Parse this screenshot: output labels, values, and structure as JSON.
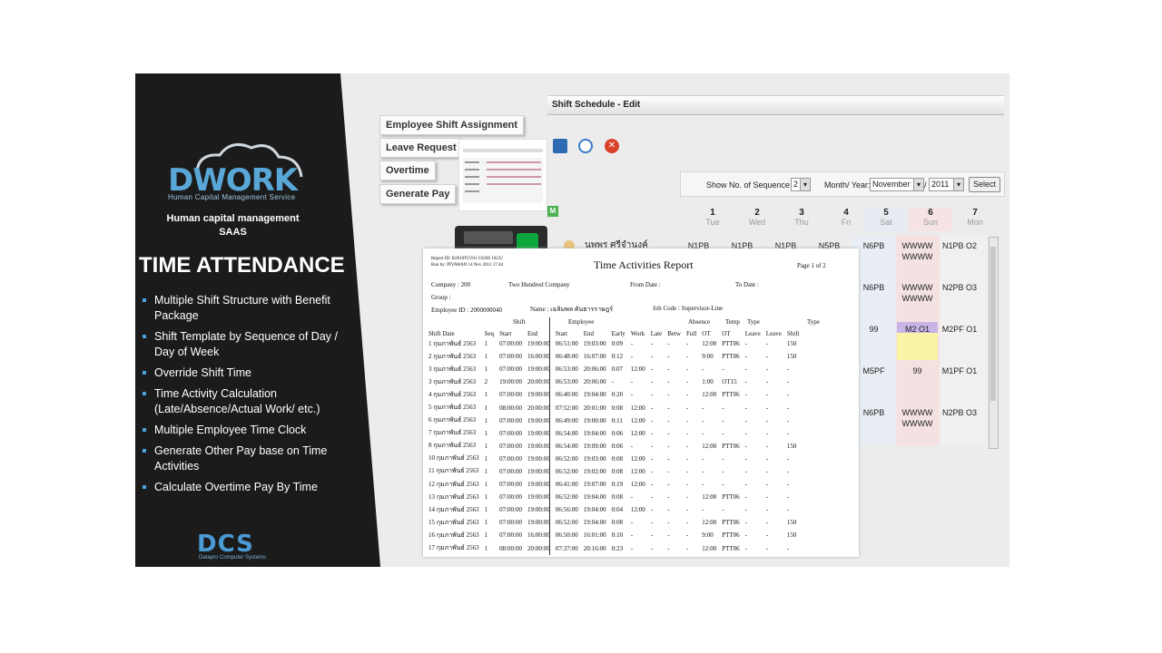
{
  "brand": {
    "logo": "DWORK",
    "logo_sub": "Human Capital Management Service",
    "tagline_1": "Human capital management",
    "tagline_2": "SAAS"
  },
  "title": "TIME ATTENDANCE",
  "features": [
    "Multiple Shift Structure with Benefit Package",
    "Shift Template by Sequence of Day / Day of Week",
    "Override Shift Time",
    "Time Activity Calculation (Late/Absence/Actual Work/ etc.)",
    "Multiple Employee Time Clock",
    "Generate Other Pay base on Time Activities",
    "Calculate Overtime Pay By Time"
  ],
  "footer_logo": {
    "text": "DCS",
    "sub": "Datapro Computer Systems"
  },
  "nav": [
    "Employee Shift Assignment",
    "Leave Request",
    "Overtime",
    "Generate Pay"
  ],
  "schedule": {
    "title": "Shift Schedule - Edit",
    "show_label": "Show No. of Sequence:",
    "sequence": "2",
    "month_label": "Month/ Year:",
    "month": "November",
    "year": "2011",
    "select_label": "Select",
    "badge": "M",
    "days": [
      {
        "num": "1",
        "name": "Tue"
      },
      {
        "num": "2",
        "name": "Wed"
      },
      {
        "num": "3",
        "name": "Thu"
      },
      {
        "num": "4",
        "name": "Fri"
      },
      {
        "num": "5",
        "name": "Sat"
      },
      {
        "num": "6",
        "name": "Sun"
      },
      {
        "num": "7",
        "name": "Mon"
      }
    ],
    "employee": "นพพร ศรีจำนงค์",
    "row1": [
      "N1PB",
      "N1PB",
      "N1PB",
      "N5PB"
    ],
    "grid": [
      [
        "N6PB",
        "WWWW WWWW",
        "N1PB O2"
      ],
      [
        "N6PB",
        "WWWW WWWW",
        "N2PB O3"
      ],
      [
        "99",
        "M2 O1",
        "M2PF O1"
      ],
      [
        "M5PF",
        "99",
        "M1PF O1"
      ],
      [
        "N6PB",
        "WWWW WWWW",
        "N2PB O3"
      ]
    ]
  },
  "report": {
    "title": "Time Activities Report",
    "page": "Page 1 of 2",
    "report_id": "Report ID: R2010TLV01   C0200   10232",
    "run_by": "Run by:   PIYAWAN   14 Nov 2011   17:44",
    "company": "Company : 200",
    "company_name": "Two Hundred Company",
    "from_date": "From Date :",
    "to_date": "To Date :",
    "group": "Group :",
    "employee_id": "Employee ID : 2000000040",
    "name": "Name : เฉลิมพล คันธารราษฎร์",
    "job_code": "Job Code : Supervisor-Line",
    "headers": [
      "Shift Date",
      "Seq",
      "Start",
      "End",
      "Start",
      "End",
      "Early",
      "Work",
      "Late",
      "Betw",
      "Full",
      "OT",
      "OT",
      "Leave",
      "Leave",
      "Shift"
    ],
    "group_headers": {
      "shift": "Shift",
      "employee": "Employee",
      "absence": "Absence",
      "temp": "Temp",
      "type": "Type",
      "type2": "Type"
    },
    "rows": [
      [
        "1 กุมภาพันธ์ 2563",
        "1",
        "07:00:00",
        "19:00:00",
        "06:51:00",
        "19:03:00",
        "0:09",
        "-",
        "-",
        "-",
        "-",
        "12:00",
        "PTT06",
        "-",
        "-",
        "150"
      ],
      [
        "2 กุมภาพันธ์ 2563",
        "1",
        "07:00:00",
        "16:00:00",
        "06:48:00",
        "16:07:00",
        "0:12",
        "-",
        "-",
        "-",
        "-",
        "9:00",
        "PTT06",
        "-",
        "-",
        "150"
      ],
      [
        "3 กุมภาพันธ์ 2563",
        "1",
        "07:00:00",
        "19:00:00",
        "06:53:00",
        "20:06:00",
        "0:07",
        "12:00",
        "-",
        "-",
        "-",
        "-",
        "-",
        "-",
        "-",
        "-"
      ],
      [
        "3 กุมภาพันธ์ 2563",
        "2",
        "19:00:00",
        "20:00:00",
        "06:53:00",
        "20:06:00",
        "-",
        "-",
        "-",
        "-",
        "-",
        "1:00",
        "OT15",
        "-",
        "-",
        "-"
      ],
      [
        "4 กุมภาพันธ์ 2563",
        "1",
        "07:00:00",
        "19:00:00",
        "06:40:00",
        "19:04:00",
        "0:20",
        "-",
        "-",
        "-",
        "-",
        "12:00",
        "PTT06",
        "-",
        "-",
        "-"
      ],
      [
        "5 กุมภาพันธ์ 2563",
        "1",
        "08:00:00",
        "20:00:00",
        "07:52:00",
        "20:01:00",
        "0:08",
        "12:00",
        "-",
        "-",
        "-",
        "-",
        "-",
        "-",
        "-",
        "-"
      ],
      [
        "6 กุมภาพันธ์ 2563",
        "1",
        "07:00:00",
        "19:00:00",
        "06:49:00",
        "19:00:00",
        "0:11",
        "12:00",
        "-",
        "-",
        "-",
        "-",
        "-",
        "-",
        "-",
        "-"
      ],
      [
        "7 กุมภาพันธ์ 2563",
        "1",
        "07:00:00",
        "19:00:00",
        "06:54:00",
        "19:04:00",
        "0:06",
        "12:00",
        "-",
        "-",
        "-",
        "-",
        "-",
        "-",
        "-",
        "-"
      ],
      [
        "8 กุมภาพันธ์ 2563",
        "1",
        "07:00:00",
        "19:00:00",
        "06:54:00",
        "19:09:00",
        "0:06",
        "-",
        "-",
        "-",
        "-",
        "12:00",
        "PTT06",
        "-",
        "-",
        "150"
      ],
      [
        "10 กุมภาพันธ์ 2563",
        "1",
        "07:00:00",
        "19:00:00",
        "06:52:00",
        "19:03:00",
        "0:08",
        "12:00",
        "-",
        "-",
        "-",
        "-",
        "-",
        "-",
        "-",
        "-"
      ],
      [
        "11 กุมภาพันธ์ 2563",
        "1",
        "07:00:00",
        "19:00:00",
        "06:52:00",
        "19:02:00",
        "0:08",
        "12:00",
        "-",
        "-",
        "-",
        "-",
        "-",
        "-",
        "-",
        "-"
      ],
      [
        "12 กุมภาพันธ์ 2563",
        "1",
        "07:00:00",
        "19:00:00",
        "06:41:00",
        "19:07:00",
        "0:19",
        "12:00",
        "-",
        "-",
        "-",
        "-",
        "-",
        "-",
        "-",
        "-"
      ],
      [
        "13 กุมภาพันธ์ 2563",
        "1",
        "07:00:00",
        "19:00:00",
        "06:52:00",
        "19:04:00",
        "0:08",
        "-",
        "-",
        "-",
        "-",
        "12:00",
        "PTT06",
        "-",
        "-",
        "-"
      ],
      [
        "14 กุมภาพันธ์ 2563",
        "1",
        "07:00:00",
        "19:00:00",
        "06:56:00",
        "19:04:00",
        "0:04",
        "12:00",
        "-",
        "-",
        "-",
        "-",
        "-",
        "-",
        "-",
        "-"
      ],
      [
        "15 กุมภาพันธ์ 2563",
        "1",
        "07:00:00",
        "19:00:00",
        "06:52:00",
        "19:04:00",
        "0:08",
        "-",
        "-",
        "-",
        "-",
        "12:00",
        "PTT06",
        "-",
        "-",
        "150"
      ],
      [
        "16 กุมภาพันธ์ 2563",
        "1",
        "07:00:00",
        "16:00:00",
        "06:50:00",
        "16:01:00",
        "0:10",
        "-",
        "-",
        "-",
        "-",
        "9:00",
        "PTT06",
        "-",
        "-",
        "150"
      ],
      [
        "17 กุมภาพันธ์ 2563",
        "1",
        "08:00:00",
        "20:00:00",
        "07:37:00",
        "20:16:00",
        "0:23",
        "-",
        "-",
        "-",
        "-",
        "12:00",
        "PTT06",
        "-",
        "-",
        "-"
      ]
    ]
  }
}
